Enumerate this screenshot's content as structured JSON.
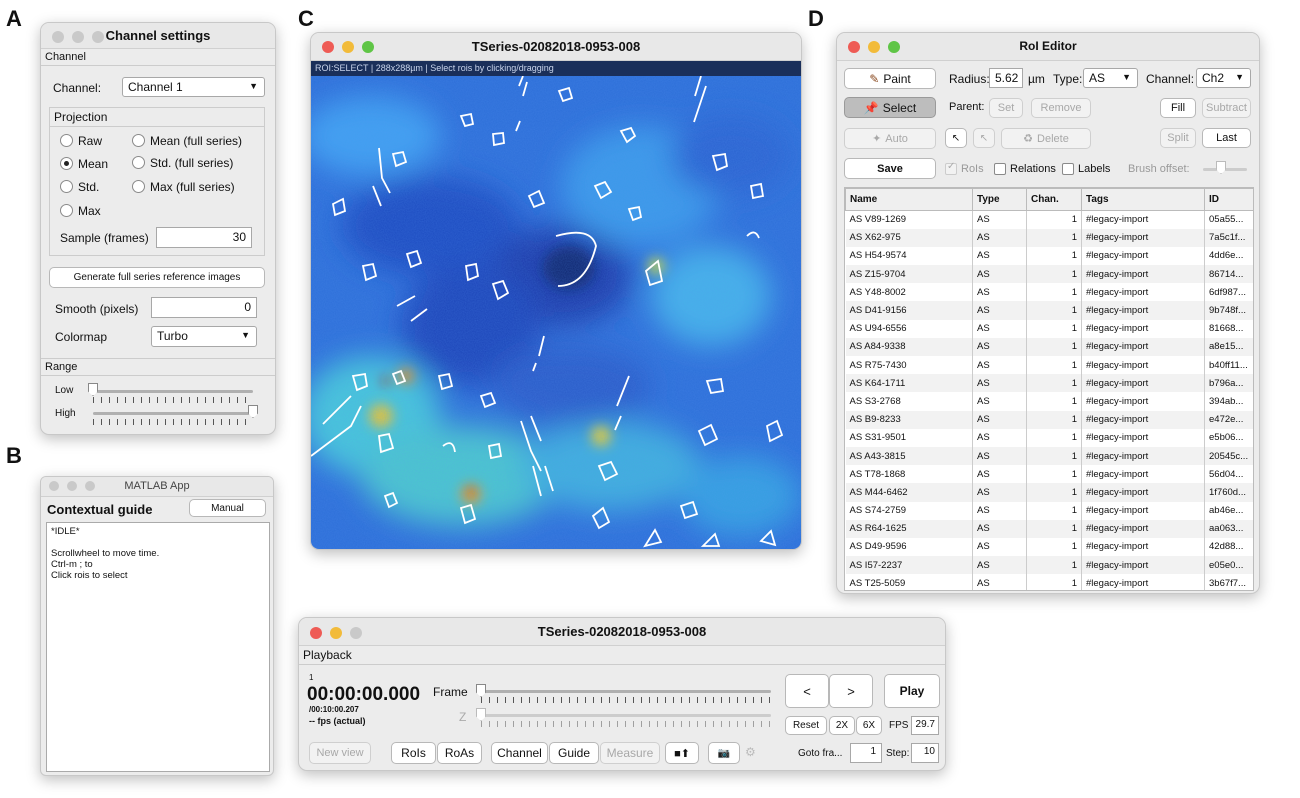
{
  "panel_labels": [
    "A",
    "B",
    "C",
    "D"
  ],
  "channel_settings": {
    "title": "Channel settings",
    "section_channel": "Channel",
    "channel_label": "Channel:",
    "channel_value": "Channel 1",
    "projection_title": "Projection",
    "radios": {
      "raw": "Raw",
      "mean": "Mean",
      "std": "Std.",
      "max": "Max",
      "mean_full": "Mean (full series)",
      "std_full": "Std. (full series)",
      "max_full": "Max (full series)"
    },
    "selected_projection": "Mean",
    "sample_label": "Sample (frames)",
    "sample_value": "30",
    "generate_button": "Generate full series reference images",
    "smooth_label": "Smooth (pixels)",
    "smooth_value": "0",
    "colormap_label": "Colormap",
    "colormap_value": "Turbo",
    "range_title": "Range",
    "low_label": "Low",
    "high_label": "High",
    "low_value": 0,
    "high_value": 1
  },
  "matlab_app": {
    "title": "MATLAB App",
    "heading": "Contextual guide",
    "manual_button": "Manual",
    "lines": [
      "*IDLE*",
      "",
      "Scrollwheel to move time.",
      "Ctrl-m ; to",
      "Click rois to select"
    ]
  },
  "image_window": {
    "title": "TSeries-02082018-0953-008",
    "status": "ROI:SELECT | 288x288µm | Select rois by clicking/dragging"
  },
  "roi_editor": {
    "title": "RoI Editor",
    "paint": "Paint",
    "select": "Select",
    "auto": "Auto",
    "save": "Save",
    "radius_label": "Radius:",
    "radius_value": "5.62",
    "radius_unit": "µm",
    "type_label": "Type:",
    "type_value": "AS",
    "channel_label": "Channel:",
    "channel_value": "Ch2",
    "parent_label": "Parent:",
    "set": "Set",
    "remove": "Remove",
    "fill": "Fill",
    "subtract": "Subtract",
    "delete": "Delete",
    "split": "Split",
    "last": "Last",
    "rois_check": "RoIs",
    "relations_check": "Relations",
    "labels_check": "Labels",
    "brush_offset": "Brush offset:",
    "columns": [
      "Name",
      "Type",
      "Chan.",
      "Tags",
      "ID"
    ],
    "rows": [
      [
        "AS V89-1269",
        "AS",
        "1",
        "#legacy-import",
        "05a55..."
      ],
      [
        "AS X62-975",
        "AS",
        "1",
        "#legacy-import",
        "7a5c1f..."
      ],
      [
        "AS H54-9574",
        "AS",
        "1",
        "#legacy-import",
        "4dd6e..."
      ],
      [
        "AS Z15-9704",
        "AS",
        "1",
        "#legacy-import",
        "86714..."
      ],
      [
        "AS Y48-8002",
        "AS",
        "1",
        "#legacy-import",
        "6df987..."
      ],
      [
        "AS D41-9156",
        "AS",
        "1",
        "#legacy-import",
        "9b748f..."
      ],
      [
        "AS U94-6556",
        "AS",
        "1",
        "#legacy-import",
        "81668..."
      ],
      [
        "AS A84-9338",
        "AS",
        "1",
        "#legacy-import",
        "a8e15..."
      ],
      [
        "AS R75-7430",
        "AS",
        "1",
        "#legacy-import",
        "b40ff11..."
      ],
      [
        "AS K64-1711",
        "AS",
        "1",
        "#legacy-import",
        "b796a..."
      ],
      [
        "AS S3-2768",
        "AS",
        "1",
        "#legacy-import",
        "394ab..."
      ],
      [
        "AS B9-8233",
        "AS",
        "1",
        "#legacy-import",
        "e472e..."
      ],
      [
        "AS S31-9501",
        "AS",
        "1",
        "#legacy-import",
        "e5b06..."
      ],
      [
        "AS A43-3815",
        "AS",
        "1",
        "#legacy-import",
        "20545c..."
      ],
      [
        "AS T78-1868",
        "AS",
        "1",
        "#legacy-import",
        "56d04..."
      ],
      [
        "AS M44-6462",
        "AS",
        "1",
        "#legacy-import",
        "1f760d..."
      ],
      [
        "AS S74-2759",
        "AS",
        "1",
        "#legacy-import",
        "ab46e..."
      ],
      [
        "AS R64-1625",
        "AS",
        "1",
        "#legacy-import",
        "aa063..."
      ],
      [
        "AS D49-9596",
        "AS",
        "1",
        "#legacy-import",
        "42d88..."
      ],
      [
        "AS I57-2237",
        "AS",
        "1",
        "#legacy-import",
        "e05e0..."
      ],
      [
        "AS T25-5059",
        "AS",
        "1",
        "#legacy-import",
        "3b67f7..."
      ]
    ]
  },
  "playback": {
    "title": "TSeries-02082018-0953-008",
    "section": "Playback",
    "frame_number": "1",
    "time": "00:00:00.000",
    "total": "/00:10:00.207",
    "fps_actual": "-- fps (actual)",
    "frame_label": "Frame",
    "z_label": "Z",
    "prev": "<",
    "next": ">",
    "play": "Play",
    "reset": "Reset",
    "speed2": "2X",
    "speed6": "6X",
    "fps_label": "FPS",
    "fps_value": "29.7",
    "goto_label": "Goto fra...",
    "goto_value": "1",
    "step_label": "Step:",
    "step_value": "10",
    "new_view": "New view",
    "rois": "RoIs",
    "roas": "RoAs",
    "channel": "Channel",
    "guide": "Guide",
    "measure": "Measure",
    "frame_position": 0
  },
  "icons": [
    "gear-icon",
    "pin-icon",
    "wand-icon",
    "trash-icon",
    "paint-icon",
    "export-icon",
    "camera-icon",
    "cursor-icon"
  ]
}
